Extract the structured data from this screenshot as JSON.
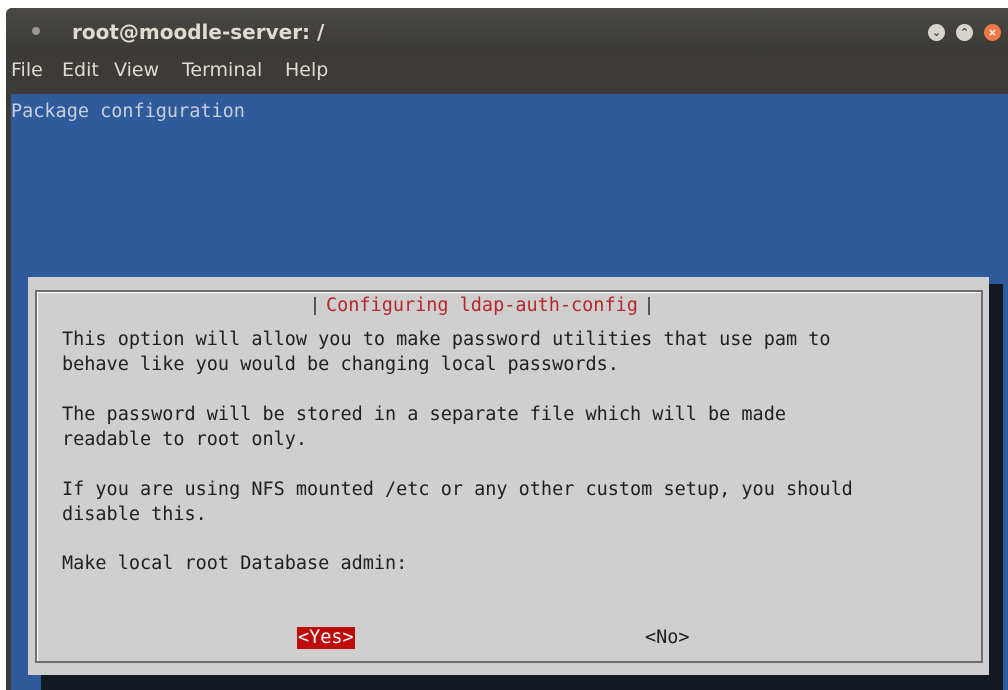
{
  "window": {
    "title": "root@moodle-server: /",
    "controls": {
      "minimize_icon": "chevron-down-icon",
      "maximize_icon": "chevron-up-icon",
      "close_icon": "close-icon"
    }
  },
  "menubar": {
    "items": [
      "File",
      "Edit",
      "View",
      "Terminal",
      "Help"
    ]
  },
  "terminal": {
    "heading": "Package configuration",
    "background_color": "#2f5a9c"
  },
  "dialog": {
    "title": "Configuring ldap-auth-config",
    "paragraphs": [
      "This option will allow you to make password utilities that use pam to\nbehave like you would be changing local passwords.",
      "The password will be stored in a separate file which will be made\nreadable to root only.",
      "If you are using NFS mounted /etc or any other custom setup, you should\ndisable this."
    ],
    "prompt": "Make local root Database admin:",
    "buttons": {
      "yes": "<Yes>",
      "no": "<No>"
    },
    "selected_button": "yes",
    "accent_color": "#c00b0b"
  }
}
